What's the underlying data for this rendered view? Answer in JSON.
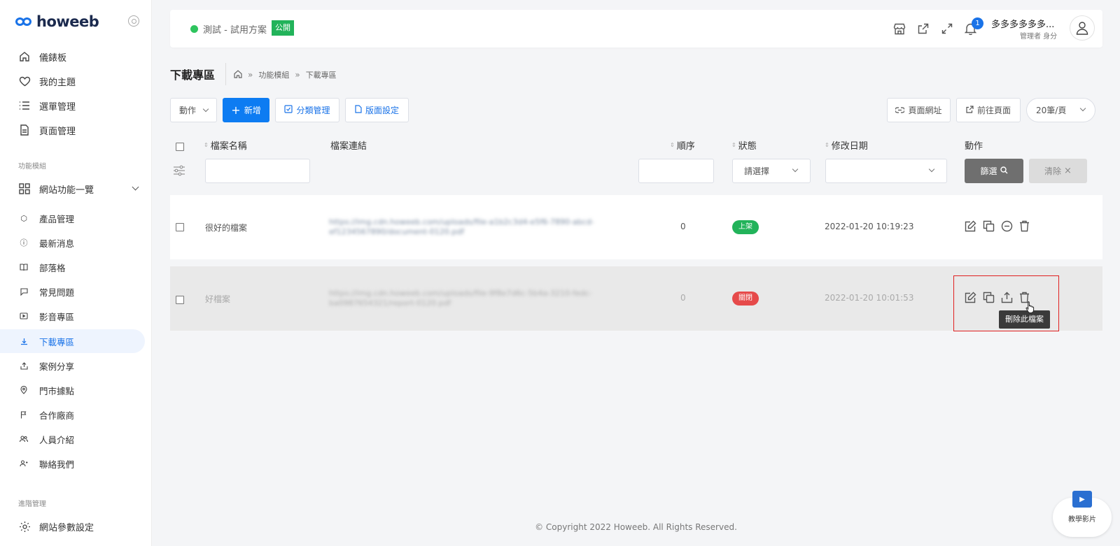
{
  "brand": {
    "logo_text": "howeeb"
  },
  "sidebar": {
    "main_items": [
      {
        "label": "儀錶板",
        "icon": "home-icon"
      },
      {
        "label": "我的主題",
        "icon": "heart-icon"
      },
      {
        "label": "選單管理",
        "icon": "list-icon"
      },
      {
        "label": "頁面管理",
        "icon": "page-icon"
      }
    ],
    "section_modules": "功能模組",
    "modules_group": "網站功能一覽",
    "module_items": [
      {
        "label": "產品管理",
        "icon": "box-icon"
      },
      {
        "label": "最新消息",
        "icon": "info-icon"
      },
      {
        "label": "部落格",
        "icon": "book-icon"
      },
      {
        "label": "常見問題",
        "icon": "chat-icon"
      },
      {
        "label": "影音專區",
        "icon": "video-icon"
      },
      {
        "label": "下載專區",
        "icon": "download-icon"
      },
      {
        "label": "案例分享",
        "icon": "share-icon"
      },
      {
        "label": "門市據點",
        "icon": "pin-icon"
      },
      {
        "label": "合作廠商",
        "icon": "flag-icon"
      },
      {
        "label": "人員介紹",
        "icon": "users-icon"
      },
      {
        "label": "聯絡我們",
        "icon": "contact-icon"
      }
    ],
    "section_advanced": "進階管理",
    "advanced_items": [
      {
        "label": "網站參數設定",
        "icon": "gear-icon"
      }
    ]
  },
  "header": {
    "site_name": "測試 - 試用方案",
    "public_badge": "公開",
    "notification_count": "1",
    "user_name": "多多多多多多...",
    "user_role": "管理者 身分"
  },
  "page": {
    "title": "下載專區",
    "breadcrumb": [
      "功能模組",
      "下載專區"
    ]
  },
  "toolbar": {
    "action_label": "動作",
    "add_label": "新增",
    "category_label": "分類管理",
    "layout_label": "版面設定",
    "page_url_label": "頁面網址",
    "goto_page_label": "前往頁面",
    "per_page_value": "20筆/頁"
  },
  "table": {
    "columns": {
      "name": "檔案名稱",
      "link": "檔案連結",
      "order": "順序",
      "status": "狀態",
      "modified": "修改日期",
      "actions": "動作"
    },
    "filters": {
      "status_placeholder": "請選擇",
      "filter_button": "篩選",
      "clear_button": "清除"
    },
    "rows": [
      {
        "name": "很好的檔案",
        "link": "https://img.cdn.howeeb.com/uploads/file-a1b2c3d4-e5f6-7890-abcd-ef1234567890/document-0120.pdf",
        "order": "0",
        "status": "上架",
        "status_color": "#22b35a",
        "modified": "2022-01-20 10:19:23"
      },
      {
        "name": "好檔案",
        "link": "https://img.cdn.howeeb.com/uploads/file-9f8e7d6c-5b4a-3210-fedc-ba0987654321/report-0120.pdf",
        "order": "0",
        "status": "關閉",
        "status_color": "#e64a4a",
        "modified": "2022-01-20 10:01:53"
      }
    ],
    "tooltip": "刪除此檔案"
  },
  "footer": {
    "copyright": "© Copyright 2022 Howeeb. All Rights Reserved."
  },
  "tutorial": {
    "label": "教學影片"
  }
}
